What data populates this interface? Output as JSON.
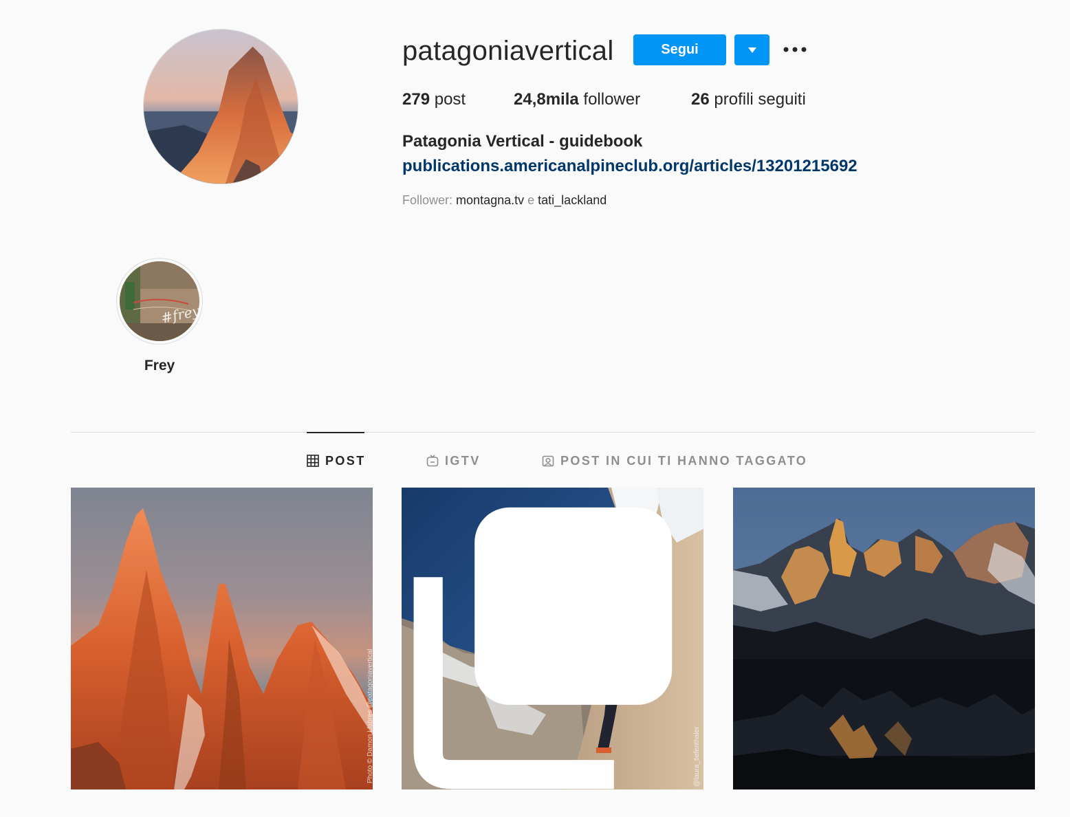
{
  "profile": {
    "username": "patagoniavertical",
    "follow_label": "Segui",
    "stats": {
      "posts_count": "279",
      "posts_label": "post",
      "followers_count": "24,8mila",
      "followers_label": "follower",
      "following_count": "26",
      "following_label": "profili seguiti"
    },
    "full_name": "Patagonia Vertical - guidebook",
    "link": "publications.americanalpineclub.org/articles/13201215692",
    "followed_by": {
      "prefix": "Follower:",
      "account1": "montagna.tv",
      "separator": "e",
      "account2": "tati_lackland"
    }
  },
  "highlights": [
    {
      "label": "Frey"
    }
  ],
  "tabs": [
    {
      "label": "POST",
      "icon": "grid-icon",
      "active": true
    },
    {
      "label": "IGTV",
      "icon": "igtv-icon",
      "active": false
    },
    {
      "label": "POST IN CUI TI HANNO TAGGATO",
      "icon": "tagged-icon",
      "active": false
    }
  ],
  "posts": [
    {
      "description": "Orange granite spires at sunrise",
      "watermark": "Photo © Damon Llabres @patagoniavertical"
    },
    {
      "description": "Climber with red pack on granite wall",
      "watermark": "@laura_tiefenthaler",
      "multi": true
    },
    {
      "description": "Mountain range reflected in dark lake",
      "watermark": ""
    }
  ],
  "colors": {
    "primary_button": "#0095f6",
    "link": "#00376b",
    "background": "#fafafa",
    "secondary_text": "#8e8e8e"
  }
}
